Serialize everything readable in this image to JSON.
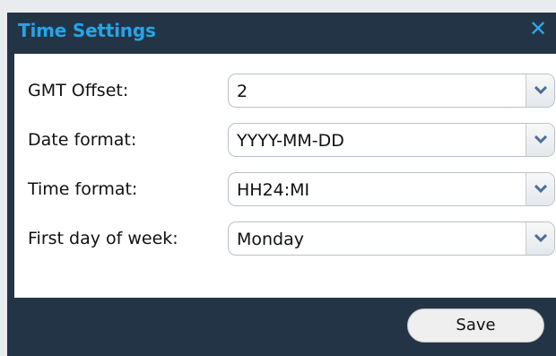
{
  "dialog": {
    "title": "Time Settings",
    "close_label": "✕"
  },
  "fields": [
    {
      "label": "GMT Offset:",
      "value": "2"
    },
    {
      "label": "Date format:",
      "value": "YYYY-MM-DD"
    },
    {
      "label": "Time format:",
      "value": "HH24:MI"
    },
    {
      "label": "First day of week:",
      "value": "Monday"
    }
  ],
  "footer": {
    "save_label": "Save"
  },
  "colors": {
    "title_accent": "#22a6e8",
    "dialog_background": "#243447",
    "content_background": "#ffffff"
  },
  "icons": {
    "close": "close-icon",
    "dropdown": "chevron-down-icon"
  }
}
